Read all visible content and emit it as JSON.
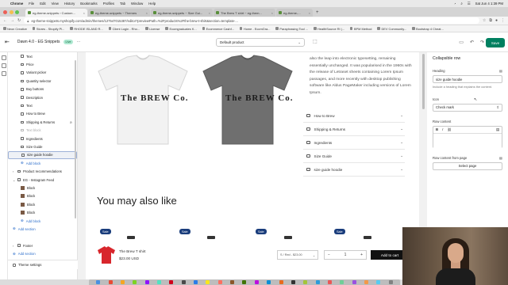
{
  "mac_menu": {
    "app": "Chrome",
    "items": [
      "File",
      "Edit",
      "View",
      "History",
      "Bookmarks",
      "Profiles",
      "Tab",
      "Window",
      "Help"
    ],
    "clock": "Sat Jun 4  1:39 PM"
  },
  "browser": {
    "tabs": [
      {
        "title": "eg-theme-snippets › Custom..."
      },
      {
        "title": "eg-theme-snippets ~ Themes"
      },
      {
        "title": "eg-theme-snippets ~ Size Gui..."
      },
      {
        "title": "The Brew T shirt ~ eg-them..."
      },
      {
        "title": "eg-theme-..."
      }
    ],
    "url": "eg-theme-snippets.myshopify.com/admin/themes/127547015387/editor?previewPath=%2Fproducts%2Fthe-brew-t-shirt&section=template-...",
    "bookmarks": [
      "Neon Creative",
      "Stores - Shopify Pl...",
      "RHODE ISLAND R...",
      "Client Login - Rho...",
      "License",
      "Ecomgraduates K...",
      "Ecommerce Cashf...",
      "Home - EcomGra...",
      "Paraphrasing Tool ...",
      "HealthSource RI |...",
      "BPM Method",
      "DEV Community...",
      "Bootstrap 4 Cheat..."
    ]
  },
  "editor": {
    "theme_name": "Dawn 4.0 - EG Snippets",
    "live_badge": "Live",
    "template_select": "Default product",
    "save_label": "Save"
  },
  "sidebar": {
    "items": [
      {
        "label": "Text",
        "level": 2,
        "state": ""
      },
      {
        "label": "Price",
        "level": 2,
        "state": ""
      },
      {
        "label": "Variant picker",
        "level": 2,
        "state": ""
      },
      {
        "label": "Quantity selector",
        "level": 2,
        "state": ""
      },
      {
        "label": "Buy buttons",
        "level": 2,
        "state": ""
      },
      {
        "label": "Description",
        "level": 2,
        "state": ""
      },
      {
        "label": "Text",
        "level": 2,
        "state": ""
      },
      {
        "label": "How to Brew",
        "level": 2,
        "state": ""
      },
      {
        "label": "Shipping & Returns",
        "level": 2,
        "state": ""
      },
      {
        "label": "Text block",
        "level": 2,
        "state": "muted"
      },
      {
        "label": "Ingredients",
        "level": 2,
        "state": ""
      },
      {
        "label": "Size Guide",
        "level": 2,
        "state": ""
      },
      {
        "label": "size guide hoodie",
        "level": 2,
        "state": "active"
      },
      {
        "label": "Add block",
        "level": 2,
        "state": "add"
      },
      {
        "label": "Product recommendations",
        "level": 1,
        "state": "section"
      },
      {
        "label": "EG - Instagram Feed",
        "level": 1,
        "state": "section-open"
      },
      {
        "label": "Block",
        "level": 2,
        "state": "thumb"
      },
      {
        "label": "Block",
        "level": 2,
        "state": "thumb"
      },
      {
        "label": "Block",
        "level": 2,
        "state": "thumb"
      },
      {
        "label": "Block",
        "level": 2,
        "state": "thumb"
      },
      {
        "label": "Add block",
        "level": 2,
        "state": "add"
      },
      {
        "label": "Add section",
        "level": 1,
        "state": "add"
      },
      {
        "label": "",
        "level": 1,
        "state": "spacer"
      },
      {
        "label": "Footer",
        "level": 1,
        "state": "section"
      },
      {
        "label": "Add section",
        "level": 1,
        "state": "add"
      }
    ],
    "theme_settings": "Theme settings"
  },
  "preview": {
    "shirt_text": "The BREW Co.",
    "description": "also the leap into electronic typesetting, remaining essentially unchanged. It was popularised in the 1960s with the release of Letraset sheets containing Lorem Ipsum passages, and more recently with desktop publishing software like Aldus PageMaker including versions of Lorem Ipsum.",
    "accordions": [
      "How to Brew",
      "Shipping & Returns",
      "Ingredients",
      "Size Guide",
      "size guide hoodie"
    ],
    "may_also_like": "You may also like",
    "sale_badge": "Sale",
    "recommended_product": {
      "name": "The Brew T shirt",
      "price": "$23.00 USD"
    },
    "sticky_variant": "S / Red - $23.00",
    "qty_value": "1",
    "add_to_cart": "Add to cart"
  },
  "settings": {
    "title": "Collapsible row",
    "heading_label": "Heading",
    "heading_value": "size guide hoodie",
    "heading_help": "Include a heading that explains the content.",
    "icon_label": "Icon",
    "icon_value": "Check mark",
    "row_content_label": "Row content",
    "rte_bold": "B",
    "rte_italic": "I",
    "row_content_from_page_label": "Row content from page",
    "select_page_label": "Select page"
  },
  "colors": {
    "save_green": "#008060",
    "live_badge_bg": "#aee9d1",
    "sale_badge": "#1a3d7c",
    "white_shirt": "#f2f2f2",
    "gray_shirt": "#6f6f6f",
    "red_shirt": "#d8262c"
  }
}
